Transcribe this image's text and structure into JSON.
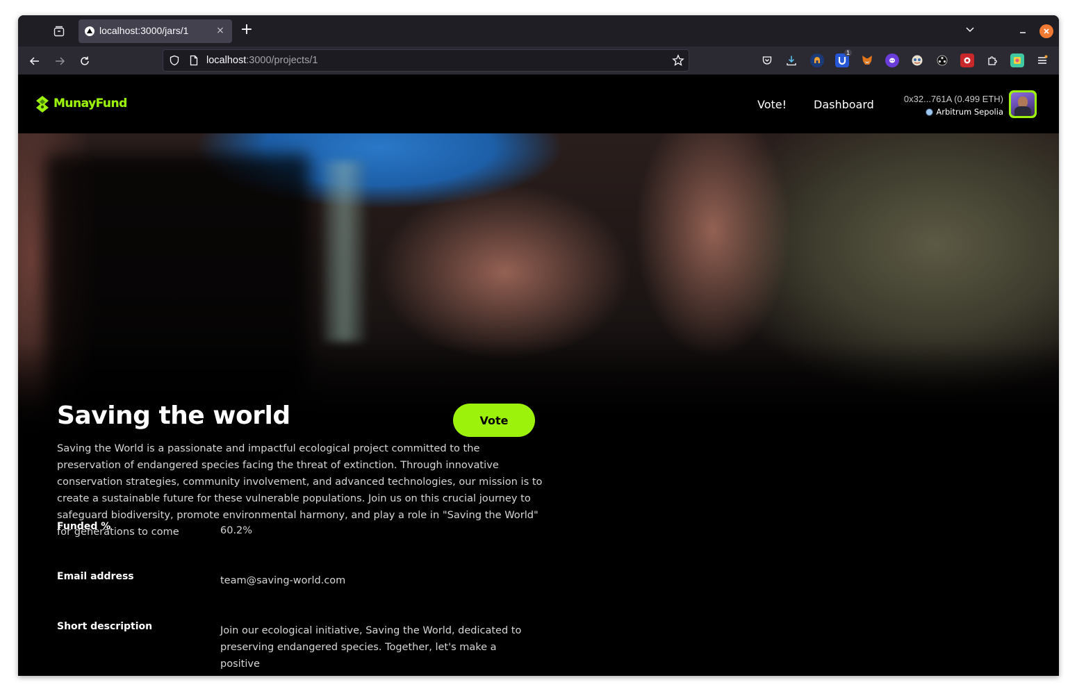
{
  "browser": {
    "tab": {
      "title": "localhost:3000/jars/1",
      "close_glyph": "×"
    },
    "new_tab_glyph": "+",
    "url": {
      "host": "localhost",
      "path": ":3000/projects/1"
    },
    "icons": [
      "tab-list-icon",
      "back-icon",
      "forward-icon",
      "reload-icon",
      "shield-icon",
      "page-icon",
      "star-icon",
      "pocket-icon",
      "download-icon",
      "extension-icon",
      "minimize-icon",
      "close-icon"
    ],
    "extension_badge": "1"
  },
  "header": {
    "logo_text": "MunayFund",
    "nav": {
      "vote": "Vote!",
      "dashboard": "Dashboard"
    },
    "account": {
      "address": "0x32...761A (0.499 ETH)",
      "network": "Arbitrum Sepolia"
    }
  },
  "project": {
    "title": "Saving the world",
    "vote_label": "Vote",
    "description": "Saving the World is a passionate and impactful ecological project committed to the preservation of endangered species facing the threat of extinction. Through innovative conservation strategies, community involvement, and advanced technologies, our mission is to create a sustainable future for these vulnerable populations. Join us on this crucial journey to safeguard biodiversity, promote environmental harmony, and play a role in \"Saving the World\" for generations to come",
    "details": [
      {
        "label": "Funded %",
        "value": "60.2%"
      },
      {
        "label": "Email address",
        "value": "team@saving-world.com"
      },
      {
        "label": "Short description",
        "value": "Join our ecological initiative, Saving the World, dedicated to preserving endangered species. Together, let's make a positive"
      }
    ]
  },
  "colors": {
    "accent": "#9cf20a",
    "page_bg": "#000000",
    "browser_chrome": "#2b2a33"
  }
}
